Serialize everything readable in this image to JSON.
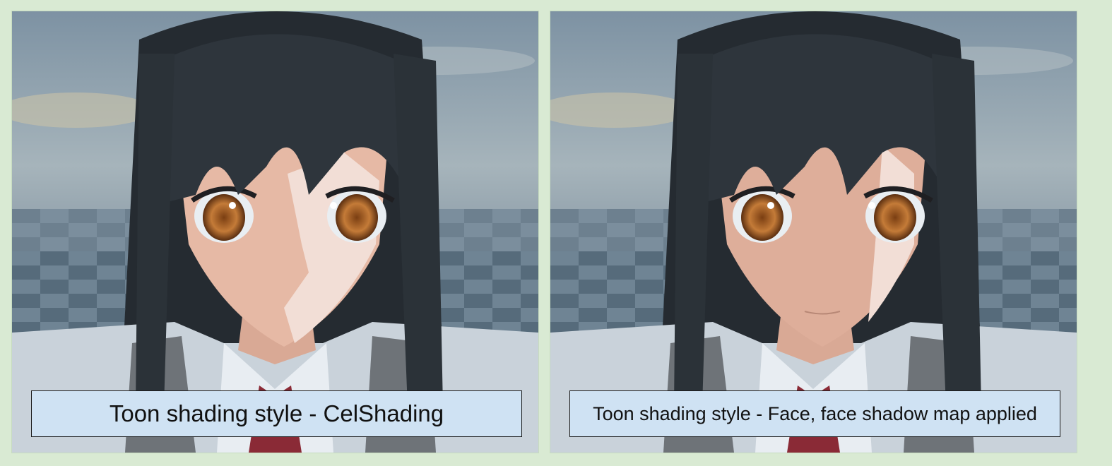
{
  "panels": [
    {
      "caption": "Toon shading style - CelShading",
      "shading": "cel",
      "shadow_side": "right"
    },
    {
      "caption": "Toon shading style - Face, face shadow map applied",
      "shading": "face-shadow-map",
      "shadow_side": "right-cheek-strip"
    }
  ],
  "colors": {
    "page_background": "#d9ead3",
    "caption_background": "#cfe2f3",
    "caption_border": "#1a1a1a",
    "hair": "#2a3036",
    "skin": "#e6b9a5",
    "skin_lit": "#f2ded6",
    "iris": "#b87333",
    "sky": "#8fa3b3",
    "floor_light": "#6f8494",
    "floor_dark": "#4f6373",
    "shirt": "#c9d2da",
    "tie": "#8a2a36"
  },
  "icons": [
    "anime-character-render"
  ]
}
